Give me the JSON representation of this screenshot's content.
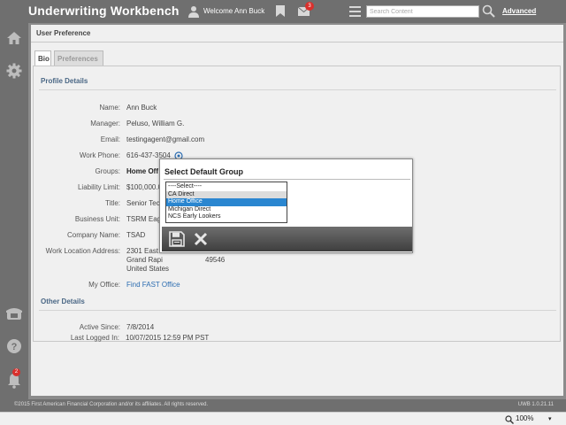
{
  "header": {
    "app_title": "Underwriting Workbench",
    "welcome": "Welcome Ann Buck",
    "mail_count": "3",
    "search_placeholder": "Search Content",
    "advanced_label": "Advanced"
  },
  "leftnav": {
    "items": [
      "home-icon",
      "settings-icon",
      "phone-icon",
      "help-icon",
      "notifications-icon"
    ],
    "notification_count": "2"
  },
  "panel": {
    "title": "User Preference",
    "tabs": [
      {
        "label": "Bio",
        "active": true
      },
      {
        "label": "Preferences",
        "active": false
      }
    ]
  },
  "profile": {
    "section_title": "Profile Details",
    "name": {
      "label": "Name:",
      "value": "Ann Buck"
    },
    "manager": {
      "label": "Manager:",
      "value": "Peluso, William G."
    },
    "email": {
      "label": "Email:",
      "value": "testingagent@gmail.com"
    },
    "work_phone": {
      "label": "Work Phone:",
      "value": "616-437-3504"
    },
    "groups": {
      "label": "Groups:",
      "value": "Home Off"
    },
    "liability_limit": {
      "label": "Liability Limit:",
      "value": "$100,000.0"
    },
    "title": {
      "label": "Title:",
      "value": "Senior Tec"
    },
    "business_unit": {
      "label": "Business Unit:",
      "value": "TSRM Eagl"
    },
    "company_name": {
      "label": "Company Name:",
      "value": "TSAD"
    },
    "work_location": {
      "label": "Work Location Address:",
      "line1": "2301 East E",
      "line2": "Grand Rapi",
      "line2_tail": "49546",
      "line3": "United States"
    },
    "my_office": {
      "label": "My Office:",
      "value": "Find FAST Office"
    }
  },
  "other": {
    "section_title": "Other Details",
    "active_since": {
      "label": "Active Since:",
      "value": "7/8/2014"
    },
    "last_logged_in": {
      "label": "Last Logged In:",
      "value": "10/07/2015 12:59 PM PST"
    }
  },
  "modal": {
    "title": "Select Default Group",
    "options": [
      "----Select----",
      "CA Direct",
      "Home Office",
      "Michigan Direct",
      "NCS Early Lookers"
    ],
    "selected": "Home Office",
    "hovered": "CA Direct"
  },
  "footer": {
    "copyright": "©2015 First American Financial Corporation and/or its affiliates. All rights reserved.",
    "version": "UWB 1.0.21.11"
  },
  "statusbar": {
    "zoom": "100%"
  },
  "colors": {
    "accent_blue": "#2a86d0",
    "section_title": "#4a6785",
    "chrome_gray": "#6f6f6f",
    "badge_red": "#d9302c"
  }
}
